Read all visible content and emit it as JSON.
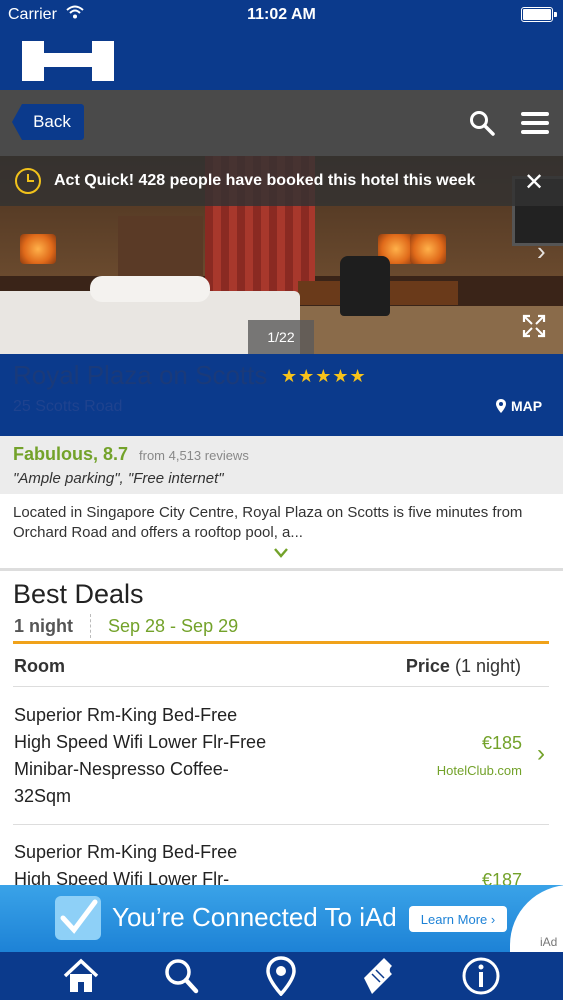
{
  "status_bar": {
    "carrier": "Carrier",
    "time": "11:02 AM"
  },
  "navbar": {
    "back_label": "Back"
  },
  "notice": {
    "text": "Act Quick! 428 people have booked this hotel this week"
  },
  "photo": {
    "counter": "1/22"
  },
  "hotel": {
    "name": "Royal Plaza on Scotts",
    "stars": "★★★★★",
    "address": "25 Scotts Road",
    "map_label": "MAP"
  },
  "rating": {
    "score": "Fabulous, 8.7",
    "count": "from 4,513 reviews",
    "quote": "\"Ample parking\", \"Free internet\""
  },
  "description": "Located in Singapore City Centre, Royal Plaza on Scotts is five minutes from Orchard Road and offers a rooftop pool, a...",
  "deals": {
    "title": "Best Deals",
    "nights": "1 night",
    "dates": "Sep 28 - Sep 29",
    "col_room": "Room",
    "col_price": "Price",
    "col_price_note": "(1 night)",
    "rows": [
      {
        "room": "Superior Rm-King Bed-Free High Speed Wifi Lower Flr-Free Minibar-Nespresso Coffee-32Sqm",
        "price": "€185",
        "source": "HotelClub.com"
      },
      {
        "room": "Superior Rm-King Bed-Free High Speed Wifi Lower Flr-",
        "price": "€187",
        "source": ""
      }
    ]
  },
  "ad": {
    "text": "You’re Connected To iAd",
    "button": "Learn More ›",
    "label": "iAd"
  },
  "tabbar": {
    "icons": [
      "home-icon",
      "search-icon",
      "location-pin-icon",
      "ticket-icon",
      "info-icon"
    ]
  },
  "colors": {
    "brand_blue": "#0b3a8c",
    "accent_green": "#73a22a",
    "accent_orange": "#f0a21a",
    "star_yellow": "#f7c31b"
  }
}
